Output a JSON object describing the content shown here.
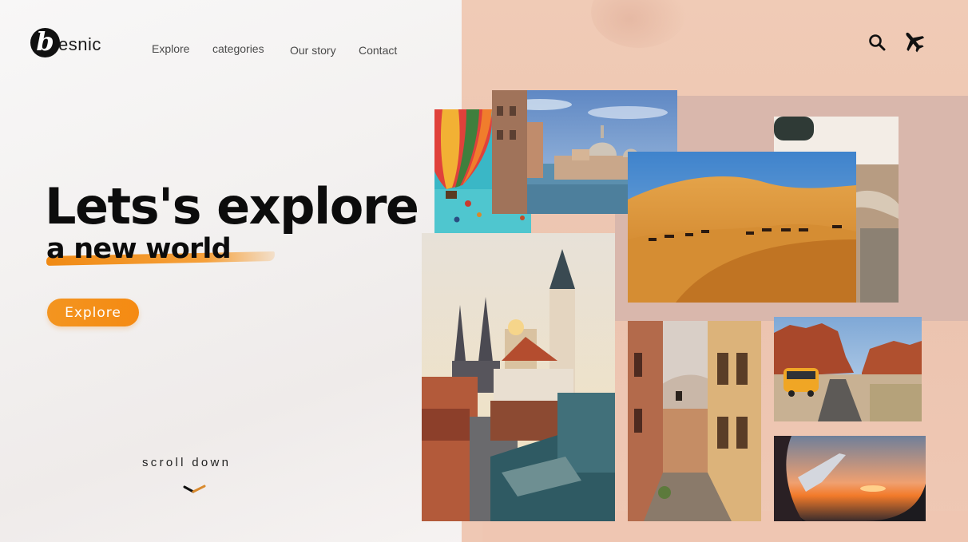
{
  "brand": {
    "logo_letter": "b",
    "logo_text": "esnic"
  },
  "nav": {
    "items": [
      {
        "label": "Explore"
      },
      {
        "label": "categories"
      },
      {
        "label": "Our story"
      },
      {
        "label": "Contact"
      }
    ]
  },
  "header_icons": [
    "search-icon",
    "airplane-icon"
  ],
  "hero": {
    "title": "Lets's explore",
    "subtitle": "a new world",
    "cta_label": "Explore"
  },
  "scroll": {
    "label": "scroll down"
  },
  "gallery": [
    {
      "subject": "hot-air-balloons"
    },
    {
      "subject": "venice-canal"
    },
    {
      "subject": "car-interior"
    },
    {
      "subject": "desert-camels"
    },
    {
      "subject": "prague-old-town"
    },
    {
      "subject": "narrow-street"
    },
    {
      "subject": "canyon-van"
    },
    {
      "subject": "airplane-window-sunset"
    }
  ],
  "colors": {
    "accent": "#f58a12",
    "panel": "#ecc4b0",
    "text": "#0c0c0c"
  }
}
